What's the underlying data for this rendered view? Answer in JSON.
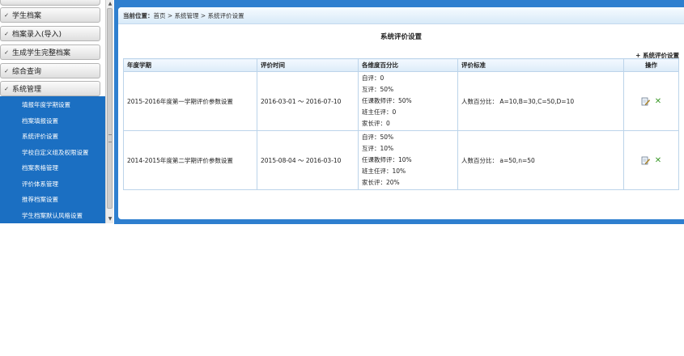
{
  "sidebar": {
    "menu": [
      {
        "label": "学生档案"
      },
      {
        "label": "档案录入(导入)"
      },
      {
        "label": "生成学生完整档案"
      },
      {
        "label": "综合查询"
      },
      {
        "label": "系统管理"
      }
    ],
    "submenu": [
      {
        "label": "填报年度学期设置"
      },
      {
        "label": "档案填报设置"
      },
      {
        "label": "系统评价设置"
      },
      {
        "label": "学校自定义组及权限设置"
      },
      {
        "label": "档案表格管理"
      },
      {
        "label": "评价体系管理"
      },
      {
        "label": "推荐档案设置"
      },
      {
        "label": "学生档案默认风格设置"
      }
    ]
  },
  "breadcrumb": {
    "prefix": "当前位置：",
    "path": "首页 > 系统管理 > 系统评价设置"
  },
  "page": {
    "title": "系统评价设置",
    "add_link": "+ 系统评价设置"
  },
  "table": {
    "headers": [
      "年度学期",
      "评价时间",
      "各维度百分比",
      "评价标准",
      "操作"
    ],
    "rows": [
      {
        "term": "2015-2016年度第一学期评价参数设置",
        "period": "2016-03-01 ～ 2016-07-10",
        "dims": [
          "自评：0",
          "互评：50%",
          "任课教师评：50%",
          "班主任评：0",
          "家长评：0"
        ],
        "standard": "人数百分比：    A=10,B=30,C=50,D=10"
      },
      {
        "term": "2014-2015年度第二学期评价参数设置",
        "period": "2015-08-04 ～ 2016-03-10",
        "dims": [
          "自评：50%",
          "互评：10%",
          "任课教师评：10%",
          "班主任评：10%",
          "家长评：20%"
        ],
        "standard": "人数百分比：    a=50,n=50"
      }
    ]
  },
  "icons": {
    "edit": "edit-icon",
    "delete": "delete-icon",
    "chevron": "chevron-down-icon"
  },
  "colors": {
    "frame_blue": "#2e7fcf",
    "submenu_blue": "#1b6fc2",
    "delete_green": "#3c9a2a"
  }
}
